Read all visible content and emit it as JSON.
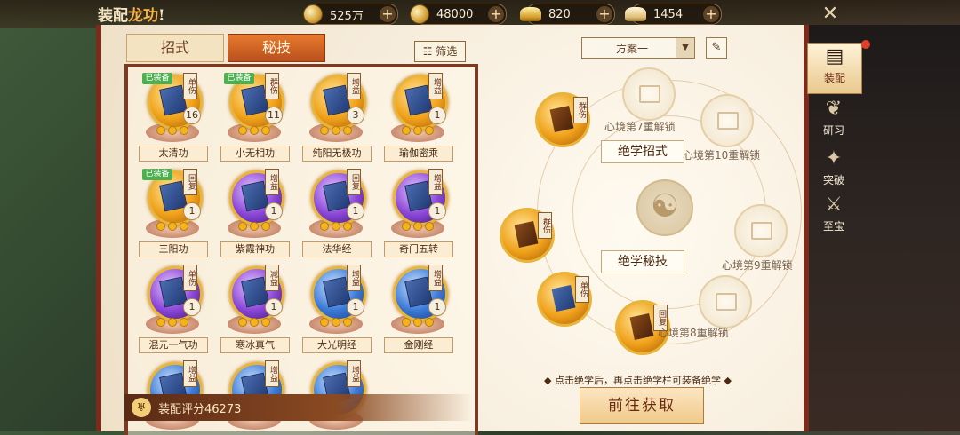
{
  "header": {
    "title_prefix": "装配",
    "title_hl": "龙功",
    "title_suffix": "!",
    "resources": [
      {
        "icon": "coin-icon",
        "value": "525万"
      },
      {
        "icon": "gold-coin-icon",
        "value": "48000"
      },
      {
        "icon": "gold-ingot-icon",
        "value": "820"
      },
      {
        "icon": "silver-ingot-icon",
        "value": "1454"
      }
    ],
    "plus_label": "+",
    "close_label": "✕"
  },
  "tabs": {
    "moves": "招式",
    "secrets": "秘技"
  },
  "filter_label": "☷ 筛选",
  "skills": [
    {
      "name": "太清功",
      "tag": "单伤",
      "level": "16",
      "equipped": "已装备",
      "color": "gold"
    },
    {
      "name": "小无相功",
      "tag": "群伤",
      "level": "11",
      "equipped": "已装备",
      "color": "gold"
    },
    {
      "name": "纯阳无极功",
      "tag": "增益",
      "level": "3",
      "equipped": "",
      "color": "gold"
    },
    {
      "name": "瑜伽密乘",
      "tag": "增益",
      "level": "1",
      "equipped": "",
      "color": "gold"
    },
    {
      "name": "三阳功",
      "tag": "回复",
      "level": "1",
      "equipped": "已装备",
      "color": "gold"
    },
    {
      "name": "紫霞神功",
      "tag": "增益",
      "level": "1",
      "equipped": "",
      "color": "purple"
    },
    {
      "name": "法华经",
      "tag": "回复",
      "level": "1",
      "equipped": "",
      "color": "purple"
    },
    {
      "name": "奇门五转",
      "tag": "增益",
      "level": "1",
      "equipped": "",
      "color": "purple"
    },
    {
      "name": "混元一气功",
      "tag": "单伤",
      "level": "1",
      "equipped": "",
      "color": "purple"
    },
    {
      "name": "寒冰真气",
      "tag": "减益",
      "level": "1",
      "equipped": "",
      "color": "purple"
    },
    {
      "name": "大光明经",
      "tag": "增益",
      "level": "1",
      "equipped": "",
      "color": "blue"
    },
    {
      "name": "金刚经",
      "tag": "增益",
      "level": "1",
      "equipped": "",
      "color": "blue"
    },
    {
      "name": "",
      "tag": "增益",
      "level": "",
      "equipped": "",
      "color": "blue"
    },
    {
      "name": "",
      "tag": "增益",
      "level": "",
      "equipped": "",
      "color": "blue"
    },
    {
      "name": "",
      "tag": "增益",
      "level": "",
      "equipped": "",
      "color": "blue"
    }
  ],
  "score": {
    "label": "装配评分46273"
  },
  "plan": {
    "selected": "方案一",
    "edit_icon": "pencil-icon"
  },
  "wheel": {
    "moves_label": "绝学招式",
    "secrets_label": "绝学秘技",
    "unlock_7": "心境第7重解锁",
    "unlock_10": "心境第10重解锁",
    "unlock_9": "心境第9重解锁",
    "unlock_8": "心境第8重解锁",
    "slot_tags": [
      "群伤",
      "群伤",
      "单伤",
      "回复"
    ]
  },
  "hint": "◆ 点击绝学后，再点击绝学栏可装备绝学 ◆",
  "go_button": "前往获取",
  "side_nav": [
    {
      "label": "装配",
      "icon": "equip-icon",
      "active": true
    },
    {
      "label": "研习",
      "icon": "study-icon",
      "active": false
    },
    {
      "label": "突破",
      "icon": "breakthrough-icon",
      "active": false
    },
    {
      "label": "至宝",
      "icon": "treasure-icon",
      "active": false
    }
  ],
  "colors": {
    "accent": "#b8501c",
    "frame": "#7a2b1c",
    "gold": "#e8b43a"
  }
}
